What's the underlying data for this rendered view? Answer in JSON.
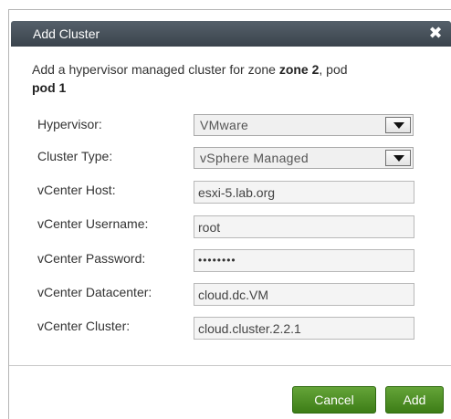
{
  "dialog": {
    "title": "Add Cluster",
    "close_icon": "close-x-icon",
    "intro": {
      "prefix": "Add a hypervisor managed cluster for zone ",
      "zone": "zone 2",
      "middle": ", pod",
      "pod": "pod 1"
    }
  },
  "form": {
    "hypervisor": {
      "label": "Hypervisor:",
      "value": "VMware"
    },
    "cluster_type": {
      "label": "Cluster Type:",
      "value": "vSphere Managed"
    },
    "vcenter_host": {
      "label": "vCenter Host:",
      "value": "esxi-5.lab.org"
    },
    "vcenter_username": {
      "label": "vCenter Username:",
      "value": "root"
    },
    "vcenter_password": {
      "label": "vCenter Password:",
      "value": "••••••••"
    },
    "vcenter_datacenter": {
      "label": "vCenter Datacenter:",
      "value": "cloud.dc.VM"
    },
    "vcenter_cluster": {
      "label": "vCenter Cluster:",
      "value": "cloud.cluster.2.2.1"
    }
  },
  "buttons": {
    "cancel": "Cancel",
    "add": "Add"
  },
  "colors": {
    "titlebar": "#444e57",
    "button_green": "#4e8f26"
  }
}
